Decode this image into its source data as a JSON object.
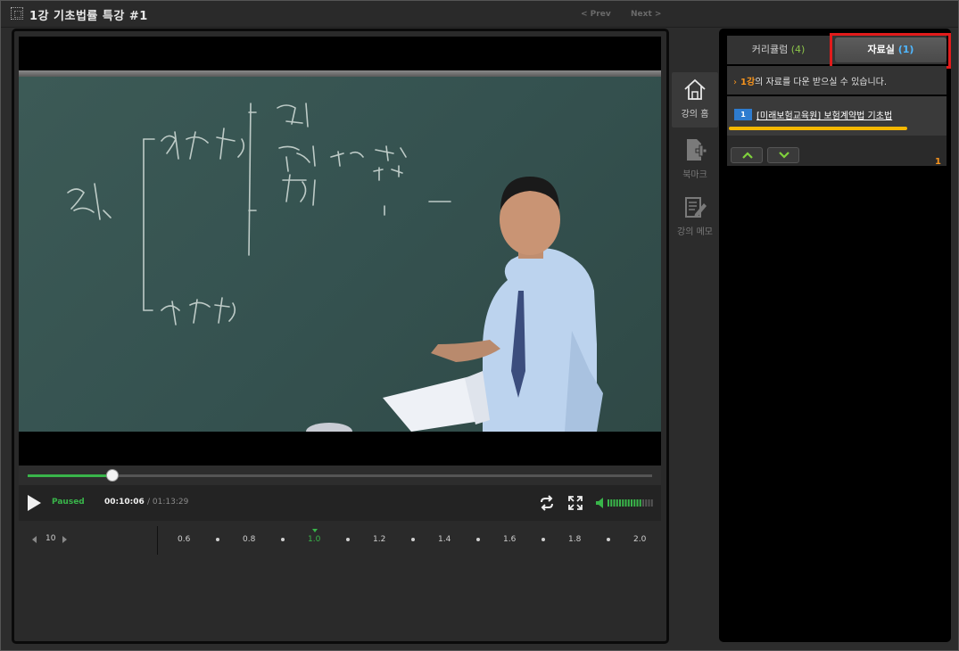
{
  "window": {
    "title": "1강  기초법률 특강 #1",
    "prev_label": "< Prev",
    "next_label": "Next >"
  },
  "player": {
    "state": "Paused",
    "current_time": "00:10:06",
    "total_time": "/ 01:13:29",
    "progress_fraction": 0.136,
    "volume_level": "high",
    "skip_seconds": "10",
    "speed_options": [
      "0.6",
      "0.8",
      "1.0",
      "1.2",
      "1.4",
      "1.6",
      "1.8",
      "2.0"
    ],
    "active_speed": "1.0"
  },
  "tools": [
    {
      "label": "강의 홈",
      "icon": "home-icon"
    },
    {
      "label": "북마크",
      "icon": "bookmark-add-icon"
    },
    {
      "label": "강의 메모",
      "icon": "memo-icon"
    }
  ],
  "panel": {
    "tabs": [
      {
        "label": "커리큘럼",
        "count": "(4)"
      },
      {
        "label": "자료실",
        "count": "(1)"
      }
    ],
    "notice_lecture": "1강",
    "notice_rest": "의 자료를 다운 받으실 수 있습니다.",
    "files": [
      {
        "index": "1",
        "name": "[미래보험교육원] 보험계약법 기초법"
      }
    ],
    "page_number": "1"
  },
  "colors": {
    "accent_green": "#39b54a",
    "accent_orange": "#f7941d",
    "highlight_red": "#e21b1b",
    "file_underline": "#f5b800",
    "tab_count_blue": "#4fb7ff"
  }
}
